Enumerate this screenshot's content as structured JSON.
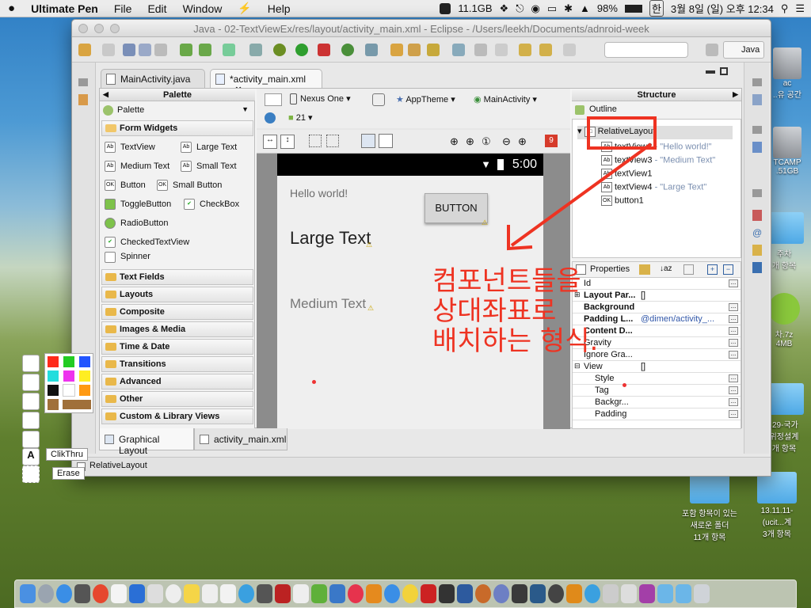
{
  "menubar": {
    "app": "Ultimate Pen",
    "items": [
      "File",
      "Edit",
      "Window",
      "Help"
    ],
    "memory": "11.1GB",
    "battery": "98%",
    "input_method": "한",
    "datetime": "3월 8일 (일) 오후 12:34"
  },
  "window": {
    "title": "Java - 02-TextViewEx/res/layout/activity_main.xml - Eclipse - /Users/leekh/Documents/adnroid-week",
    "perspective": "Java",
    "tabs": [
      {
        "label": "MainActivity.java",
        "active": false
      },
      {
        "label": "*activity_main.xml",
        "active": true
      }
    ],
    "bottom_tabs": [
      {
        "label": "Graphical Layout",
        "active": true
      },
      {
        "label": "activity_main.xml",
        "active": false
      }
    ],
    "status": "RelativeLayout"
  },
  "palette": {
    "title": "Palette",
    "selector": "Palette",
    "open_category": "Form Widgets",
    "widgets": [
      [
        "TextView",
        "Large Text"
      ],
      [
        "Medium Text",
        "Small Text"
      ],
      [
        "Button",
        "Small Button"
      ],
      [
        "ToggleButton",
        "CheckBox"
      ],
      [
        "RadioButton"
      ],
      [
        "CheckedTextView"
      ],
      [
        "Spinner"
      ]
    ],
    "categories": [
      "Text Fields",
      "Layouts",
      "Composite",
      "Images & Media",
      "Time & Date",
      "Transitions",
      "Advanced",
      "Other",
      "Custom & Library Views"
    ]
  },
  "canvas_toolbar": {
    "device": "Nexus One",
    "theme": "AppTheme",
    "activity": "MainActivity",
    "api": "21",
    "error_count": "9"
  },
  "device_preview": {
    "time": "5:00",
    "hello": "Hello world!",
    "button": "BUTTON",
    "large": "Large Text",
    "medium": "Medium Text"
  },
  "structure": {
    "title": "Structure",
    "outline_title": "Outline",
    "root": "RelativeLayout",
    "children": [
      {
        "name": "textView2",
        "detail": "- \"Hello world!\""
      },
      {
        "name": "textView3",
        "detail": "- \"Medium Text\""
      },
      {
        "name": "textView1",
        "detail": ""
      },
      {
        "name": "textView4",
        "detail": "- \"Large Text\""
      },
      {
        "name": "button1",
        "detail": ""
      }
    ]
  },
  "properties": {
    "title": "Properties",
    "rows": [
      {
        "key": "Id",
        "value": "",
        "bold": false
      },
      {
        "key": "Layout Par...",
        "value": "[]",
        "bold": true
      },
      {
        "key": "Background",
        "value": "",
        "bold": true
      },
      {
        "key": "Padding L...",
        "value": "@dimen/activity_...",
        "bold": true
      },
      {
        "key": "Content D...",
        "value": "",
        "bold": true
      },
      {
        "key": "Gravity",
        "value": "",
        "bold": false
      },
      {
        "key": "Ignore Gra...",
        "value": "",
        "bold": false
      },
      {
        "key": "View",
        "value": "[]",
        "bold": false
      },
      {
        "key": "Style",
        "value": "",
        "bold": false
      },
      {
        "key": "Tag",
        "value": "",
        "bold": false
      },
      {
        "key": "Backgr...",
        "value": "",
        "bold": false
      },
      {
        "key": "Padding",
        "value": "",
        "bold": false
      }
    ]
  },
  "annotation": {
    "lines": [
      "컴포넌트들을",
      "상대좌표로",
      "배치하는 형식."
    ],
    "color": "#ee3322"
  },
  "pen_tools": {
    "tip1": "ClikThru",
    "tip2": "Erase",
    "colors": [
      "#ff2a1a",
      "#22cc22",
      "#2255ff",
      "#22dddd",
      "#ee33ee",
      "#ffee22",
      "#111111",
      "#ffffff",
      "#ff9911",
      "#a0703a",
      "#a0703a"
    ]
  },
  "desktop_icons": [
    {
      "label": "ac\n..유 공간"
    },
    {
      "label": "TCAMP\n.51GB"
    },
    {
      "label": "주차\n개 항목"
    },
    {
      "label": "차.7z\n4MB"
    },
    {
      "label": ".29-국가\n위정설계\n개 항목"
    },
    {
      "label": "포함 항목이 있는\n새로운 폴더\n11개 항목"
    },
    {
      "label": "13.11.11-\n(ucit...계\n3개 항목"
    }
  ]
}
